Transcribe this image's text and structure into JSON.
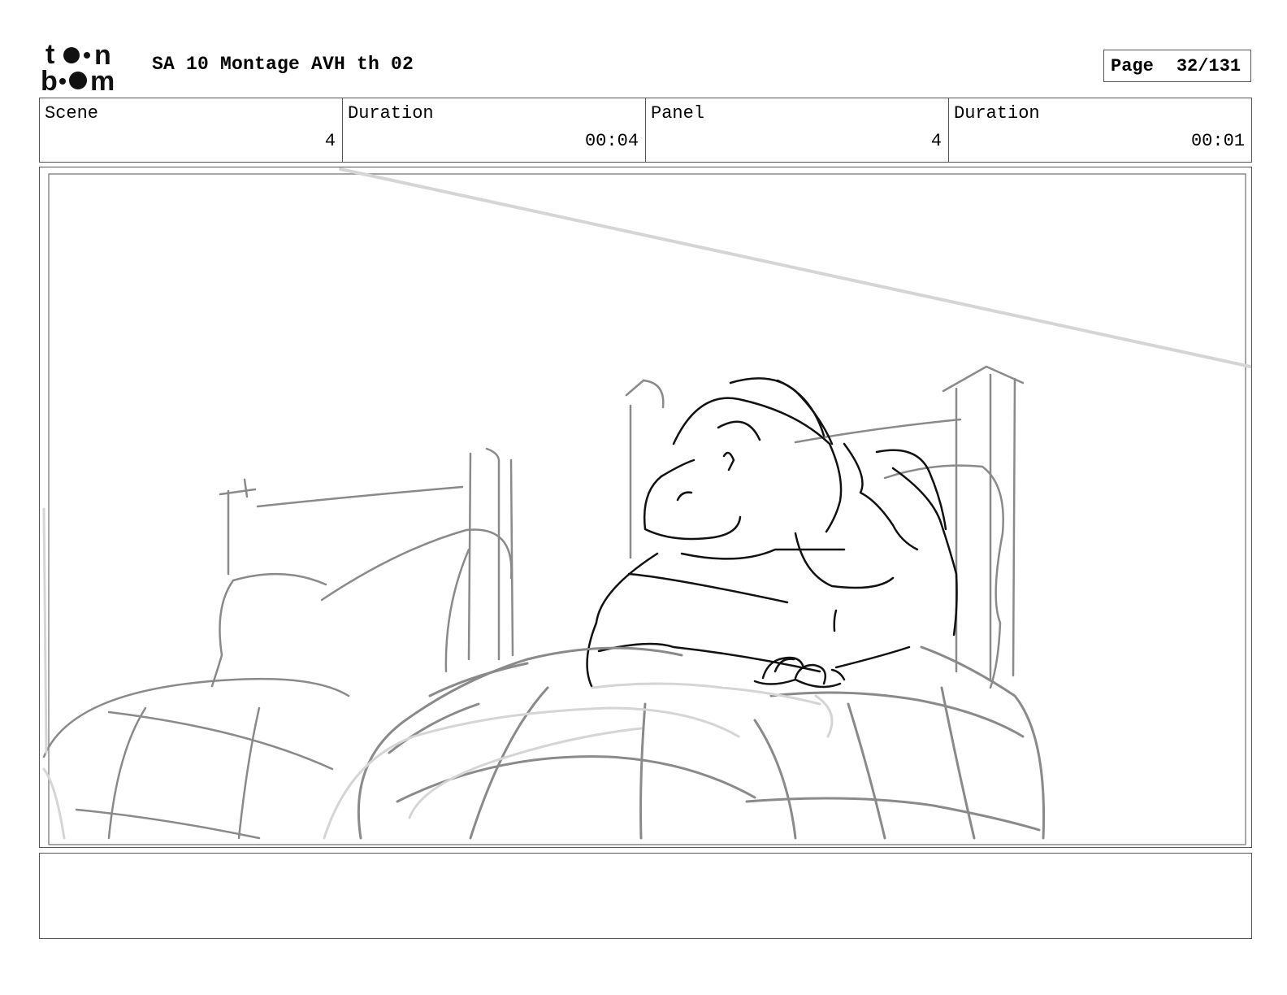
{
  "logo": {
    "text": "toon boom",
    "icon": "toon-boom-logo-icon"
  },
  "header": {
    "title": "SA 10 Montage AVH th 02",
    "page_label": "Page",
    "page_value": "32/131"
  },
  "info": [
    {
      "caption": "Scene",
      "value": "4"
    },
    {
      "caption": "Duration",
      "value": "00:04"
    },
    {
      "caption": "Panel",
      "value": "4"
    },
    {
      "caption": "Duration",
      "value": "00:01"
    }
  ],
  "panel": {
    "icon": "storyboard-sketch-icon"
  },
  "notes": {
    "text": ""
  },
  "colors": {
    "sketch_dark": "#111111",
    "sketch_mid": "#8a8a8a",
    "sketch_light": "#d5d5d5",
    "border": "#555555"
  }
}
